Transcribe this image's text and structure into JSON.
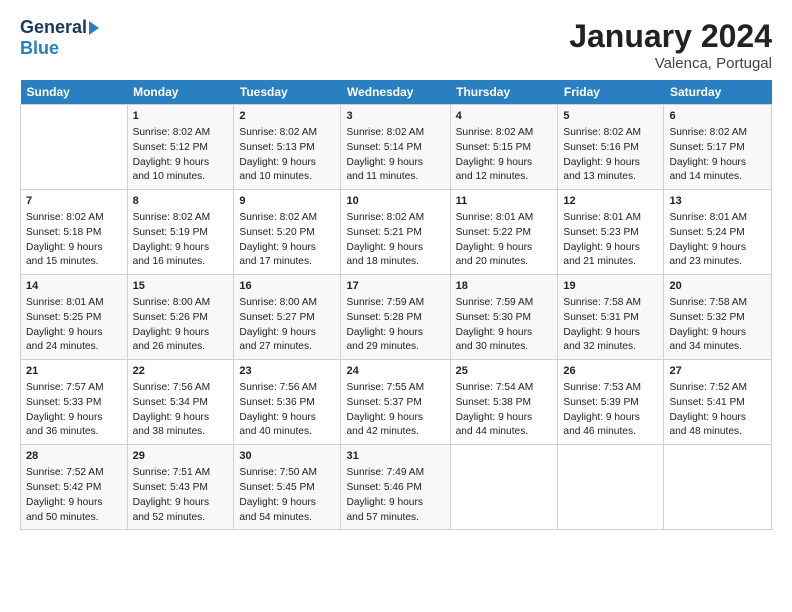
{
  "logo": {
    "line1": "General",
    "line2": "Blue"
  },
  "title": "January 2024",
  "subtitle": "Valenca, Portugal",
  "days_of_week": [
    "Sunday",
    "Monday",
    "Tuesday",
    "Wednesday",
    "Thursday",
    "Friday",
    "Saturday"
  ],
  "weeks": [
    [
      {
        "day": "",
        "content": ""
      },
      {
        "day": "1",
        "content": "Sunrise: 8:02 AM\nSunset: 5:12 PM\nDaylight: 9 hours\nand 10 minutes."
      },
      {
        "day": "2",
        "content": "Sunrise: 8:02 AM\nSunset: 5:13 PM\nDaylight: 9 hours\nand 10 minutes."
      },
      {
        "day": "3",
        "content": "Sunrise: 8:02 AM\nSunset: 5:14 PM\nDaylight: 9 hours\nand 11 minutes."
      },
      {
        "day": "4",
        "content": "Sunrise: 8:02 AM\nSunset: 5:15 PM\nDaylight: 9 hours\nand 12 minutes."
      },
      {
        "day": "5",
        "content": "Sunrise: 8:02 AM\nSunset: 5:16 PM\nDaylight: 9 hours\nand 13 minutes."
      },
      {
        "day": "6",
        "content": "Sunrise: 8:02 AM\nSunset: 5:17 PM\nDaylight: 9 hours\nand 14 minutes."
      }
    ],
    [
      {
        "day": "7",
        "content": "Sunrise: 8:02 AM\nSunset: 5:18 PM\nDaylight: 9 hours\nand 15 minutes."
      },
      {
        "day": "8",
        "content": "Sunrise: 8:02 AM\nSunset: 5:19 PM\nDaylight: 9 hours\nand 16 minutes."
      },
      {
        "day": "9",
        "content": "Sunrise: 8:02 AM\nSunset: 5:20 PM\nDaylight: 9 hours\nand 17 minutes."
      },
      {
        "day": "10",
        "content": "Sunrise: 8:02 AM\nSunset: 5:21 PM\nDaylight: 9 hours\nand 18 minutes."
      },
      {
        "day": "11",
        "content": "Sunrise: 8:01 AM\nSunset: 5:22 PM\nDaylight: 9 hours\nand 20 minutes."
      },
      {
        "day": "12",
        "content": "Sunrise: 8:01 AM\nSunset: 5:23 PM\nDaylight: 9 hours\nand 21 minutes."
      },
      {
        "day": "13",
        "content": "Sunrise: 8:01 AM\nSunset: 5:24 PM\nDaylight: 9 hours\nand 23 minutes."
      }
    ],
    [
      {
        "day": "14",
        "content": "Sunrise: 8:01 AM\nSunset: 5:25 PM\nDaylight: 9 hours\nand 24 minutes."
      },
      {
        "day": "15",
        "content": "Sunrise: 8:00 AM\nSunset: 5:26 PM\nDaylight: 9 hours\nand 26 minutes."
      },
      {
        "day": "16",
        "content": "Sunrise: 8:00 AM\nSunset: 5:27 PM\nDaylight: 9 hours\nand 27 minutes."
      },
      {
        "day": "17",
        "content": "Sunrise: 7:59 AM\nSunset: 5:28 PM\nDaylight: 9 hours\nand 29 minutes."
      },
      {
        "day": "18",
        "content": "Sunrise: 7:59 AM\nSunset: 5:30 PM\nDaylight: 9 hours\nand 30 minutes."
      },
      {
        "day": "19",
        "content": "Sunrise: 7:58 AM\nSunset: 5:31 PM\nDaylight: 9 hours\nand 32 minutes."
      },
      {
        "day": "20",
        "content": "Sunrise: 7:58 AM\nSunset: 5:32 PM\nDaylight: 9 hours\nand 34 minutes."
      }
    ],
    [
      {
        "day": "21",
        "content": "Sunrise: 7:57 AM\nSunset: 5:33 PM\nDaylight: 9 hours\nand 36 minutes."
      },
      {
        "day": "22",
        "content": "Sunrise: 7:56 AM\nSunset: 5:34 PM\nDaylight: 9 hours\nand 38 minutes."
      },
      {
        "day": "23",
        "content": "Sunrise: 7:56 AM\nSunset: 5:36 PM\nDaylight: 9 hours\nand 40 minutes."
      },
      {
        "day": "24",
        "content": "Sunrise: 7:55 AM\nSunset: 5:37 PM\nDaylight: 9 hours\nand 42 minutes."
      },
      {
        "day": "25",
        "content": "Sunrise: 7:54 AM\nSunset: 5:38 PM\nDaylight: 9 hours\nand 44 minutes."
      },
      {
        "day": "26",
        "content": "Sunrise: 7:53 AM\nSunset: 5:39 PM\nDaylight: 9 hours\nand 46 minutes."
      },
      {
        "day": "27",
        "content": "Sunrise: 7:52 AM\nSunset: 5:41 PM\nDaylight: 9 hours\nand 48 minutes."
      }
    ],
    [
      {
        "day": "28",
        "content": "Sunrise: 7:52 AM\nSunset: 5:42 PM\nDaylight: 9 hours\nand 50 minutes."
      },
      {
        "day": "29",
        "content": "Sunrise: 7:51 AM\nSunset: 5:43 PM\nDaylight: 9 hours\nand 52 minutes."
      },
      {
        "day": "30",
        "content": "Sunrise: 7:50 AM\nSunset: 5:45 PM\nDaylight: 9 hours\nand 54 minutes."
      },
      {
        "day": "31",
        "content": "Sunrise: 7:49 AM\nSunset: 5:46 PM\nDaylight: 9 hours\nand 57 minutes."
      },
      {
        "day": "",
        "content": ""
      },
      {
        "day": "",
        "content": ""
      },
      {
        "day": "",
        "content": ""
      }
    ]
  ]
}
